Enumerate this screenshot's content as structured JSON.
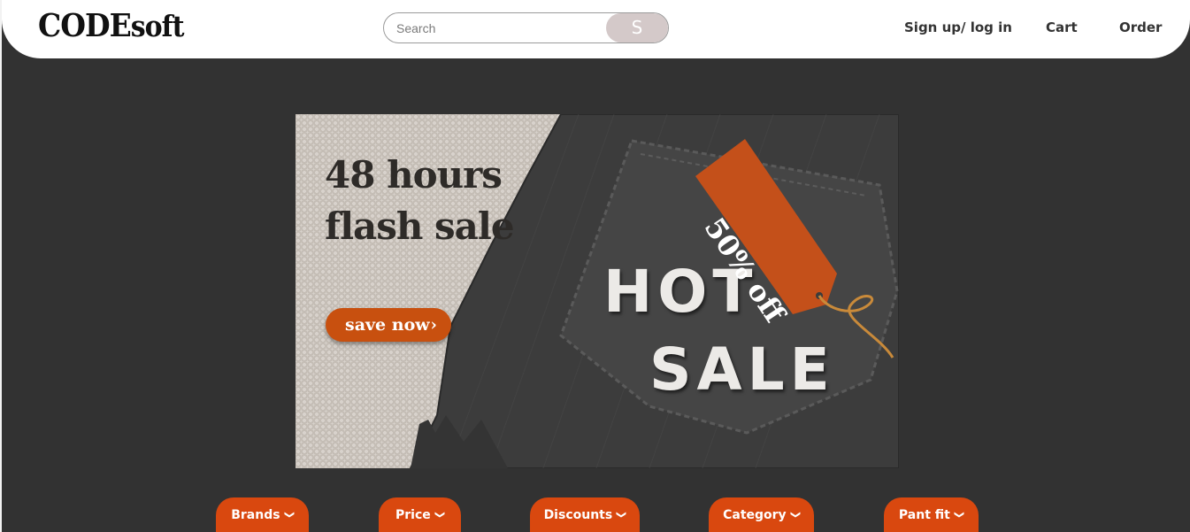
{
  "header": {
    "logo_bold": "CODE",
    "logo_light": "soft",
    "search_placeholder": "Search",
    "search_button": "S",
    "nav": [
      "Sign up/ log in",
      "Cart",
      "Order"
    ]
  },
  "banner": {
    "headline_line1": "48 hours",
    "headline_line2": "flash sale",
    "cta_label": "save now",
    "cta_icon": "chevron-right-icon",
    "hot_text": "HOT",
    "sale_text": "SALE",
    "tag_text": "50% off"
  },
  "filters": [
    {
      "label": "Brands",
      "icon": "chevron-down-icon"
    },
    {
      "label": "Price",
      "icon": "chevron-down-icon"
    },
    {
      "label": "Discounts",
      "icon": "chevron-down-icon"
    },
    {
      "label": "Category",
      "icon": "chevron-down-icon"
    },
    {
      "label": "Pant fit",
      "icon": "chevron-down-icon"
    }
  ],
  "colors": {
    "page_background": "#323232",
    "accent": "#d9480f",
    "search_button": "#d4c9c9"
  }
}
